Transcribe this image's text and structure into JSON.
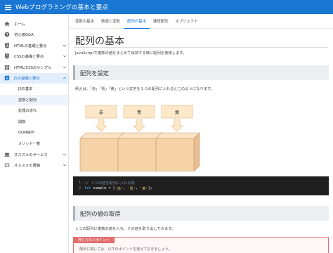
{
  "app": {
    "title": "Webプログラミングの基本と要点"
  },
  "sidebar": {
    "items": [
      {
        "label": "ホーム",
        "icon": "home-icon"
      },
      {
        "label": "初心者Q&A",
        "icon": "help-circle-icon"
      },
      {
        "label": "HTMLの基礎と要点",
        "icon": "html5-icon"
      },
      {
        "label": "CSSの基礎と要点",
        "icon": "css3-icon"
      },
      {
        "label": "HTML/CSSのサンプル",
        "icon": "grid-icon"
      },
      {
        "label": "JSの基礎と要点",
        "icon": "js-icon"
      }
    ],
    "sub_items": [
      "JSの基本",
      "変数と配列",
      "処理の流れ",
      "関数",
      "DOM操作",
      "メソッド一覧"
    ],
    "bottom_items": [
      {
        "label": "オススメのサービス",
        "icon": "laptop-icon"
      },
      {
        "label": "オススメの書籍",
        "icon": "book-icon"
      }
    ]
  },
  "tabs": [
    "変数の基本",
    "数値と変数",
    "配列の基本",
    "連想配列",
    "オブジェクト"
  ],
  "content": {
    "title": "配列の基本",
    "intro": "JavaScriptで複数の値をまとめて保持する時に配列を使用します。",
    "section1": "配列を設定",
    "section1_text": "例えば、「赤」「青」「黄」という文字を１つの配列に入れるとこのようになります。",
    "diagram": {
      "labels": [
        "赤",
        "青",
        "黄"
      ]
    },
    "code": {
      "line1_no": "1",
      "line2_no": "2",
      "comment": "// ３つの値を配列に入れる例",
      "kw": "let",
      "plain1": " sample = [",
      "s1": "'赤'",
      "sep1": ", ",
      "s2": "'青'",
      "sep2": ", ",
      "s3": "'黄'",
      "plain2": "];"
    },
    "section2": "配列の値の取得",
    "section2_text": "１つの配列に複数の値を入れ、その値を取り出してみます。",
    "callout": {
      "tag": "押さえたいポイント",
      "text": "配列に関しては、以下のポイントを覚えておきましょう。"
    }
  },
  "colors": {
    "appbar": "#1976d2",
    "callout": "#e26d6d",
    "box_fill": "#f5d2a8",
    "label_fill": "#fde9c9"
  }
}
